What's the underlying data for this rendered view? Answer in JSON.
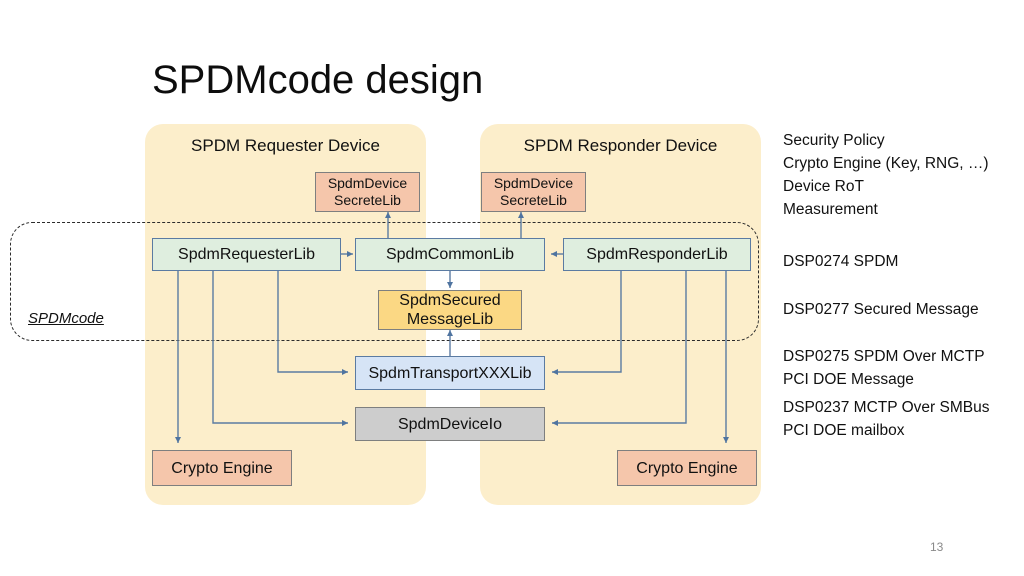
{
  "slide": {
    "title": "SPDMcode design",
    "page_number": "13"
  },
  "boundary": {
    "label": "SPDMcode"
  },
  "panels": [
    {
      "id": "requester",
      "title": "SPDM Requester\nDevice"
    },
    {
      "id": "responder",
      "title": "SPDM Responder\nDevice"
    }
  ],
  "nodes": {
    "requester_secret": "SpdmDevice\nSecreteLib",
    "responder_secret": "SpdmDevice\nSecreteLib",
    "requester_lib": "SpdmRequesterLib",
    "common_lib": "SpdmCommonLib",
    "responder_lib": "SpdmResponderLib",
    "secured_message_lib": "SpdmSecured\nMessageLib",
    "transport_lib": "SpdmTransportXXXLib",
    "device_io": "SpdmDeviceIo",
    "crypto_engine_left": "Crypto Engine",
    "crypto_engine_right": "Crypto Engine"
  },
  "notes": {
    "platform": "Security Policy\nCrypto Engine (Key, RNG, …)\nDevice RoT\nMeasurement",
    "spec_spdm": "DSP0274 SPDM",
    "spec_secured": "DSP0277 Secured Message",
    "spec_mctp": "DSP0275 SPDM Over MCTP\nPCI DOE Message",
    "spec_smbus": "DSP0237 MCTP Over SMBus\nPCI DOE mailbox"
  },
  "colors": {
    "panel_bg": "#fceecb",
    "green_box": "#dfeedf",
    "salmon_box": "#f5c6ab",
    "yellow_box": "#fbd884",
    "blue_box": "#d6e4f6",
    "gray_box": "#cdcdcd",
    "connector": "#5b7ba2",
    "boundary_dash": "#2b2b2b"
  }
}
